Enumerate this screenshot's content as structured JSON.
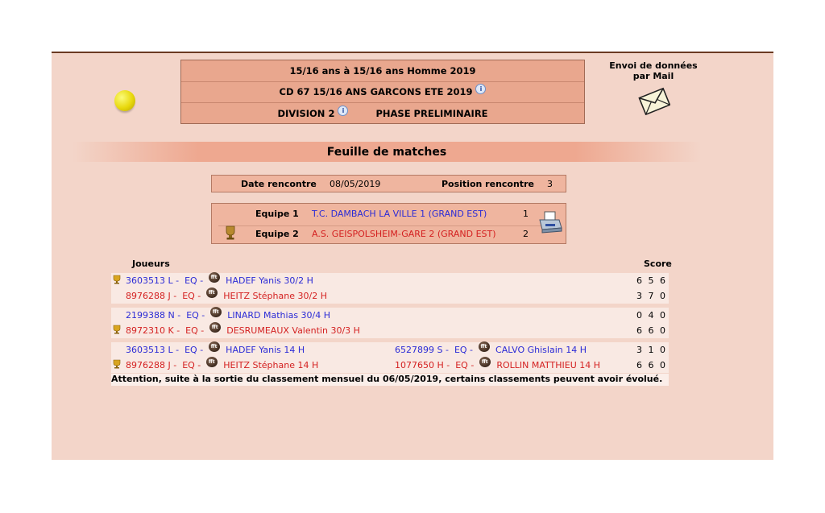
{
  "header": {
    "line1": "15/16 ans  à 15/16 ans  Homme  2019",
    "line2": "CD 67 15/16 ANS GARCONS ETE 2019",
    "division": "DIVISION 2",
    "phase": "PHASE PRELIMINAIRE"
  },
  "mail": {
    "line1": "Envoi de données",
    "line2": "par Mail"
  },
  "section_title": "Feuille de matches",
  "meeting": {
    "date_label": "Date rencontre",
    "date_value": "08/05/2019",
    "position_label": "Position rencontre",
    "position_value": "3"
  },
  "teams": [
    {
      "label": "Equipe 1",
      "name": "T.C. DAMBACH LA VILLE 1 (GRAND EST)",
      "score": "1"
    },
    {
      "label": "Equipe 2",
      "name": "A.S. GEISPOLSHEIM-GARE 2 (GRAND EST)",
      "score": "2"
    }
  ],
  "table": {
    "players_header": "Joueurs",
    "score_header": "Score",
    "matches": [
      {
        "rows": [
          {
            "player1": {
              "license": "3603513 L -",
              "eq": "EQ -",
              "name": "HADEF  Yanis  30/2 H"
            },
            "score": "6 5 6"
          },
          {
            "player1": {
              "license": "8976288 J -",
              "eq": "EQ -",
              "name": "HEITZ  Stéphane 30/2 H"
            },
            "score": "3 7 0"
          }
        ]
      },
      {
        "rows": [
          {
            "player1": {
              "license": "2199388 N -",
              "eq": "EQ -",
              "name": "LINARD  Mathias  30/4 H"
            },
            "score": "0 4 0"
          },
          {
            "player1": {
              "license": "8972310 K -",
              "eq": "EQ -",
              "name": "DESRUMEAUX  Valentin 30/3 H"
            },
            "score": "6 6 0"
          }
        ]
      },
      {
        "rows": [
          {
            "player1": {
              "license": "3603513 L -",
              "eq": "EQ -",
              "name": "HADEF  Yanis  14 H"
            },
            "player2": {
              "license": "6527899 S -",
              "eq": "EQ -",
              "name": "CALVO  Ghislain  14 H"
            },
            "score": "3 1 0"
          },
          {
            "player1": {
              "license": "8976288 J -",
              "eq": "EQ -",
              "name": "HEITZ  Stéphane 14 H"
            },
            "player2": {
              "license": "1077650 H -",
              "eq": "EQ -",
              "name": "ROLLIN  MATTHIEU 14 H"
            },
            "score": "6 6 0"
          }
        ]
      }
    ]
  },
  "warning": "Attention, suite à la sortie du classement mensuel du 06/05/2019, certains classements peuvent avoir évolué.",
  "badge_text": "fft",
  "colors": {
    "team1": "#2b2bd6",
    "team2": "#d42121",
    "header_bg": "#e9a78e",
    "panel_bg": "#f3d5c9"
  }
}
